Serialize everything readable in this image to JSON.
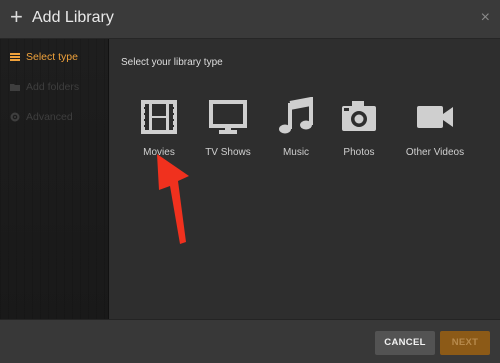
{
  "header": {
    "title": "Add Library",
    "close_glyph": "×"
  },
  "sidebar": {
    "items": [
      {
        "label": "Select type",
        "icon": "stack-icon",
        "state": "active"
      },
      {
        "label": "Add folders",
        "icon": "folder-icon",
        "state": "disabled"
      },
      {
        "label": "Advanced",
        "icon": "gear-icon",
        "state": "disabled"
      }
    ]
  },
  "main": {
    "prompt": "Select your library type",
    "types": [
      {
        "label": "Movies",
        "icon": "film-icon"
      },
      {
        "label": "TV Shows",
        "icon": "tv-icon"
      },
      {
        "label": "Music",
        "icon": "music-note-icon"
      },
      {
        "label": "Photos",
        "icon": "camera-icon"
      },
      {
        "label": "Other Videos",
        "icon": "video-camera-icon"
      }
    ]
  },
  "footer": {
    "cancel_label": "CANCEL",
    "next_label": "NEXT"
  },
  "colors": {
    "accent": "#f0a23b",
    "annotation_arrow": "#f0311e",
    "next_disabled": "#8c5a17"
  }
}
